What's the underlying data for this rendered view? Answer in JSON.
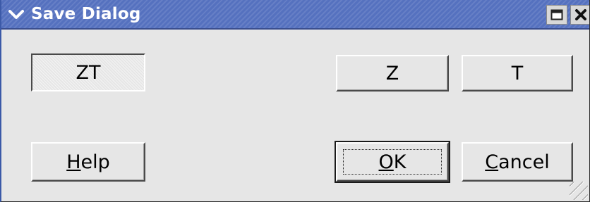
{
  "window": {
    "title": "Save Dialog",
    "icons": {
      "menu": "chevron-down-icon",
      "maximize": "maximize-icon",
      "close": "close-icon"
    },
    "colors": {
      "titlebar": "#5571bf",
      "background": "#e6e6e6"
    }
  },
  "buttons": {
    "zt": {
      "label": "ZT",
      "state": "pressed"
    },
    "z": {
      "label": "Z"
    },
    "t": {
      "label": "T"
    },
    "help": {
      "mnemonic": "H",
      "rest": "elp"
    },
    "ok": {
      "mnemonic": "O",
      "rest": "K",
      "default": true,
      "focused": true
    },
    "cancel": {
      "mnemonic": "C",
      "rest": "ancel"
    }
  }
}
